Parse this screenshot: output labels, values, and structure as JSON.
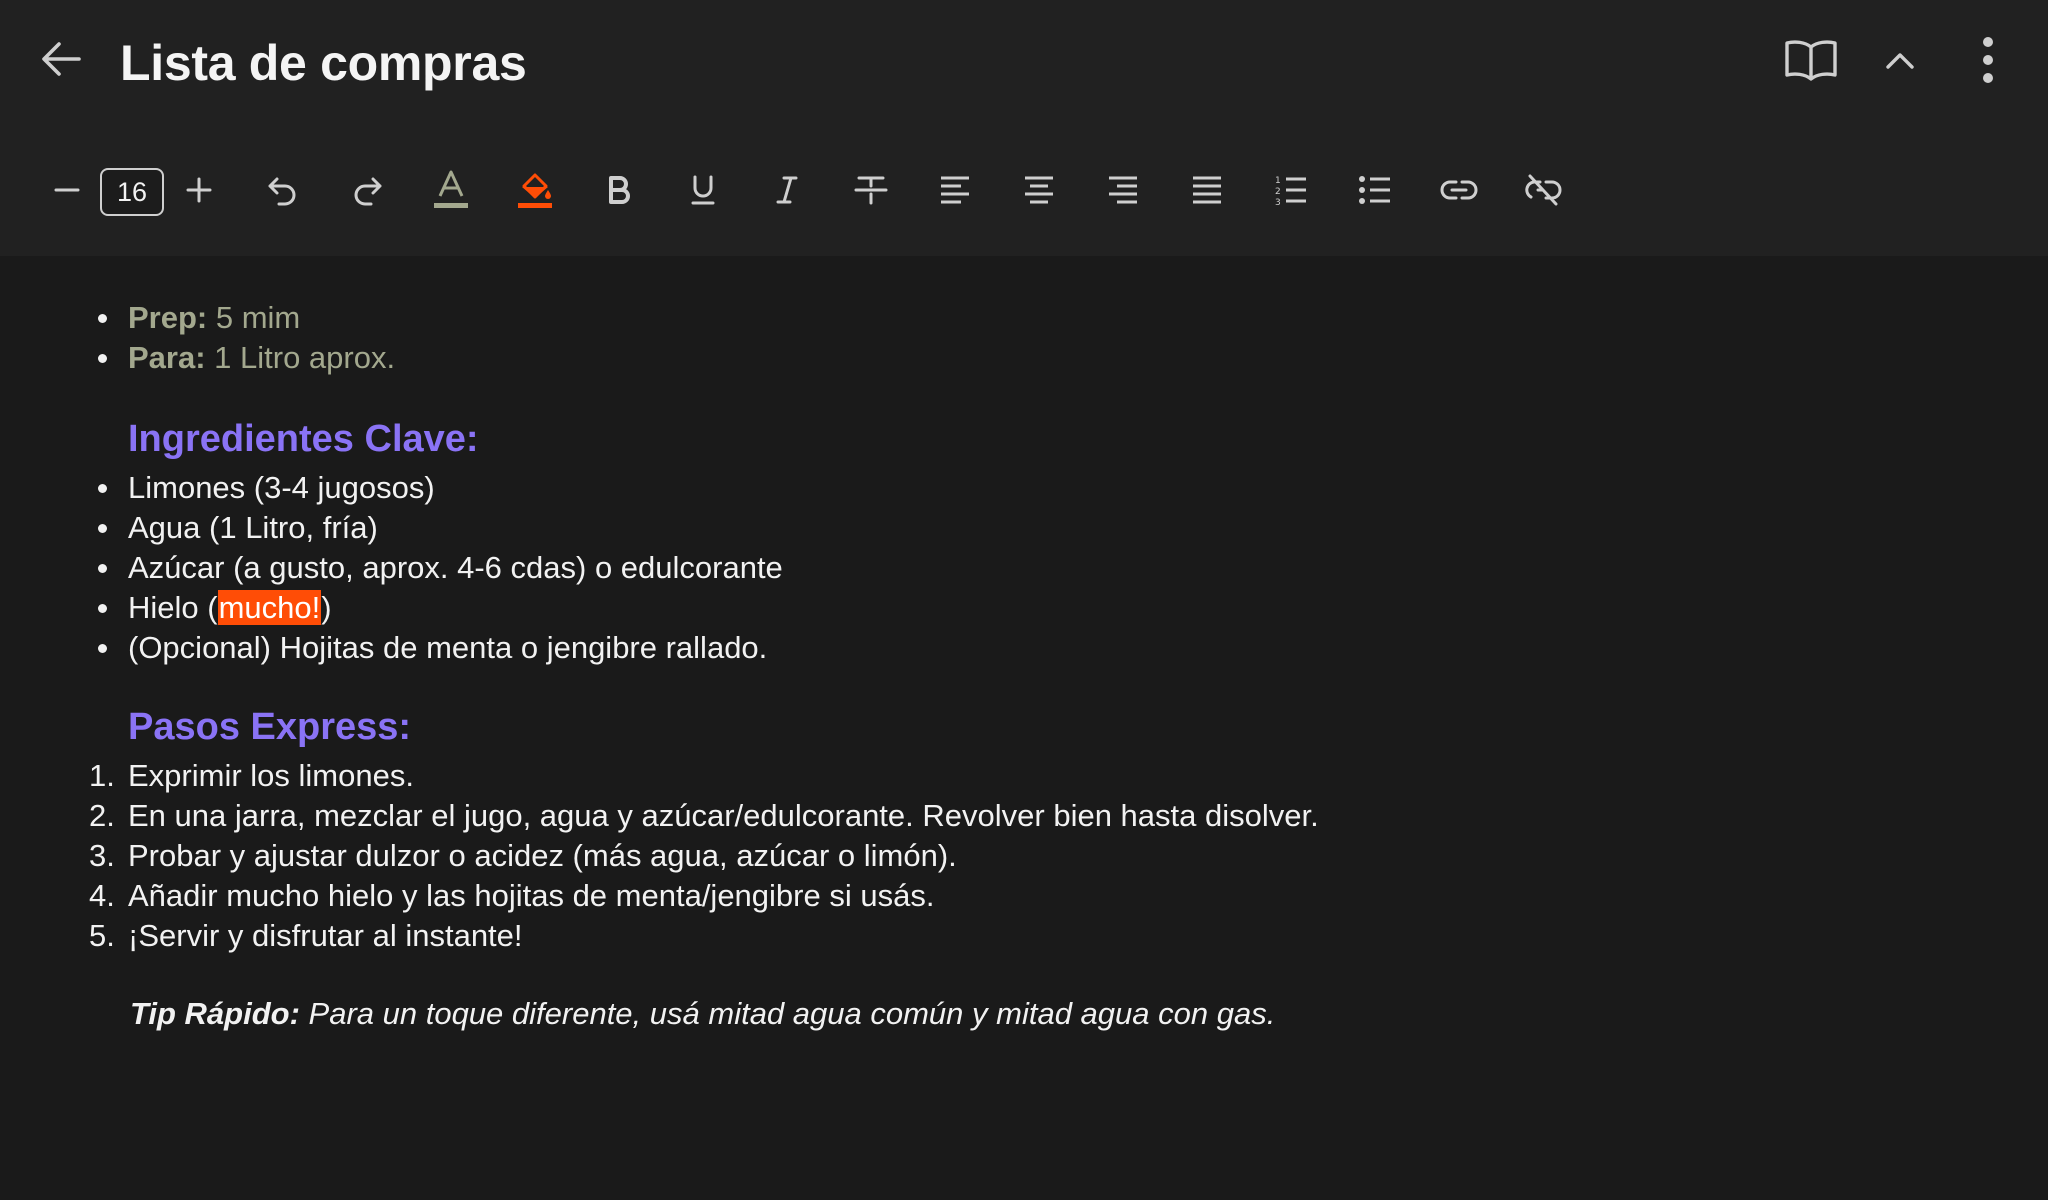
{
  "header": {
    "title": "Lista de compras",
    "icons": [
      "arrow-left-icon",
      "book-open-icon",
      "chevron-up-icon",
      "more-vertical-icon"
    ]
  },
  "toolbar": {
    "font_size": "16",
    "buttons": [
      "decrease-font",
      "increase-font",
      "undo",
      "redo",
      "text-color",
      "highlight-color",
      "bold",
      "underline",
      "italic",
      "strikethrough",
      "align-left",
      "align-center",
      "align-right",
      "align-justify",
      "numbered-list",
      "bulleted-list",
      "insert-link",
      "remove-link"
    ],
    "text_color": "#a3a88e",
    "highlight_color": "#ff4d06"
  },
  "note": {
    "meta": [
      {
        "label": "Prep:",
        "value": " 5 mim"
      },
      {
        "label": "Para:",
        "value": " 1 Litro aprox."
      }
    ],
    "heading_ingredients": "Ingredientes Clave:",
    "ingredients": [
      {
        "text": "Limones (3-4 jugosos)"
      },
      {
        "text": "Agua (1 Litro, fría)"
      },
      {
        "text": "Azúcar (a gusto, aprox. 4-6 cdas) o edulcorante"
      },
      {
        "before": "Hielo (",
        "highlight": "mucho!",
        "after": ")"
      },
      {
        "text": "(Opcional) Hojitas de menta o jengibre rallado."
      }
    ],
    "heading_steps": "Pasos Express:",
    "steps": [
      {
        "num": "1.",
        "text": "Exprimir los limones."
      },
      {
        "num": "2.",
        "text": "En una jarra, mezclar el jugo, agua y azúcar/edulcorante. Revolver bien hasta disolver."
      },
      {
        "num": "3.",
        "text": "Probar y ajustar dulzor o acidez (más agua, azúcar o limón)."
      },
      {
        "num": "4.",
        "text": "Añadir mucho hielo y las hojitas de menta/jengibre si usás."
      },
      {
        "num": "5.",
        "text": "¡Servir y disfrutar al instante!"
      }
    ],
    "tip_label": "Tip Rápido:",
    "tip_text": " Para un toque diferente, usá mitad agua común y mitad agua con gas.",
    "colors": {
      "heading": "#8a73f5",
      "meta": "#a3a88e",
      "highlight": "#ff4d06"
    }
  }
}
